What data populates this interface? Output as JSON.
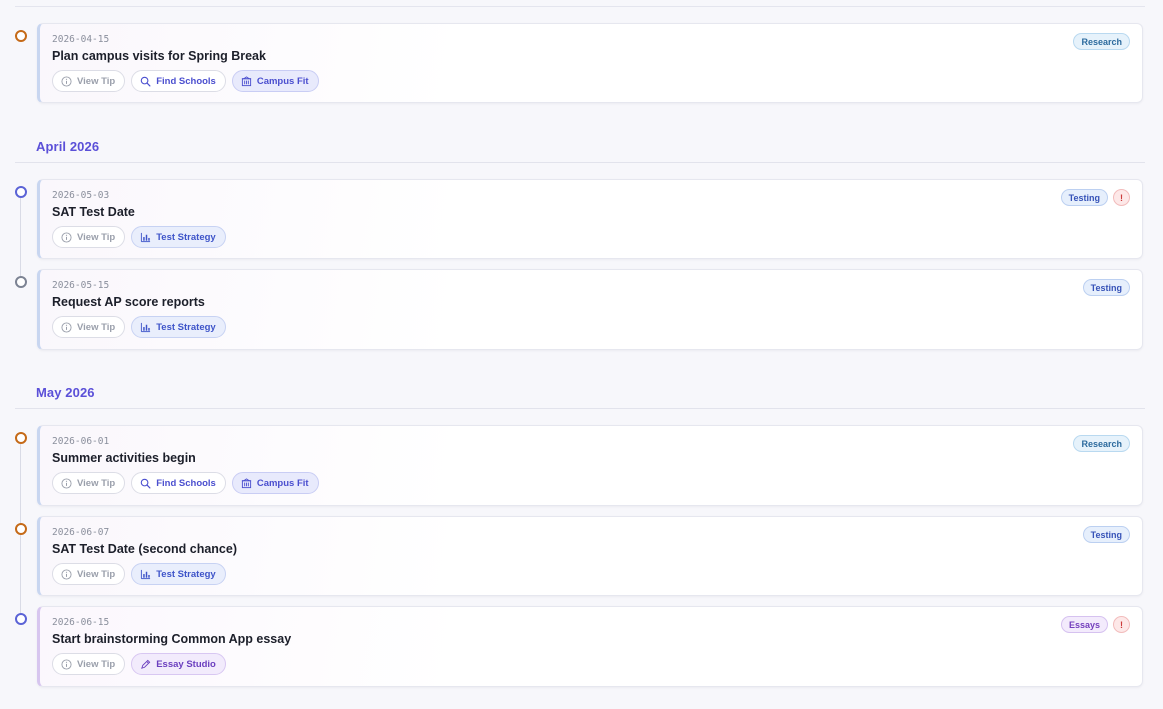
{
  "months": [
    {
      "label": "April 2026"
    },
    {
      "label": "May 2026"
    }
  ],
  "buttons": {
    "view_tip": "View Tip",
    "find_schools": "Find Schools",
    "campus_fit": "Campus Fit",
    "test_strategy": "Test Strategy",
    "essay_studio": "Essay Studio"
  },
  "alert_symbol": "!",
  "events": [
    {
      "date": "2026-04-15",
      "title": "Plan campus visits for Spring Break",
      "tag": "Research",
      "dot_color": "#c56a18"
    },
    {
      "date": "2026-05-03",
      "title": "SAT Test Date",
      "tag": "Testing",
      "alert": true,
      "dot_color": "#5b63d6"
    },
    {
      "date": "2026-05-15",
      "title": "Request AP score reports",
      "tag": "Testing",
      "dot_color": "#7c8393"
    },
    {
      "date": "2026-06-01",
      "title": "Summer activities begin",
      "tag": "Research",
      "dot_color": "#c56a18"
    },
    {
      "date": "2026-06-07",
      "title": "SAT Test Date (second chance)",
      "tag": "Testing",
      "dot_color": "#c56a18"
    },
    {
      "date": "2026-06-15",
      "title": "Start brainstorming Common App essay",
      "tag": "Essays",
      "alert": true,
      "dot_color": "#5b63d6"
    }
  ],
  "colors": {
    "accent": "#5b50d8",
    "research": "#2d6b9e",
    "testing": "#3753b8",
    "essays": "#7440bd",
    "alert": "#cc3b3b"
  }
}
